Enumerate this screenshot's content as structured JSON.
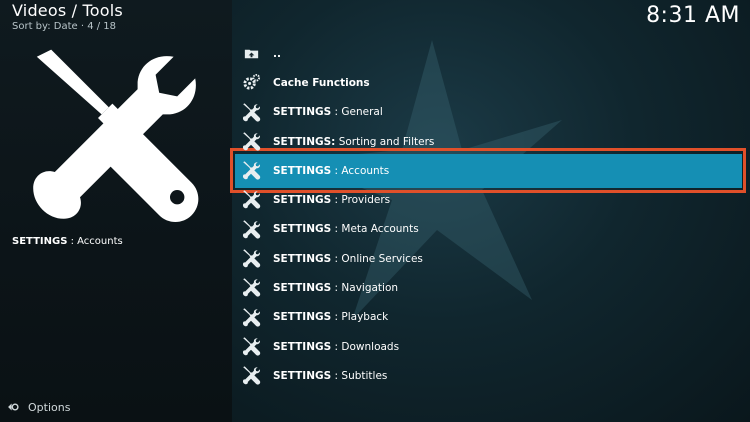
{
  "header": {
    "title": "Videos / Tools",
    "sort_label": "Sort by: Date · 4 / 18",
    "clock": "8:31 AM"
  },
  "left": {
    "big_icon": "tools-icon",
    "selected_prefix": "SETTINGS",
    "selected_suffix": " : Accounts",
    "options_label": "Options"
  },
  "list": {
    "items": [
      {
        "icon": "folder-up-icon",
        "bold": "..",
        "rest": ""
      },
      {
        "icon": "gears-icon",
        "bold": "Cache Functions",
        "rest": ""
      },
      {
        "icon": "tools-icon",
        "bold": "SETTINGS",
        "rest": " : General"
      },
      {
        "icon": "tools-icon",
        "bold": "SETTINGS:",
        "rest": " Sorting and Filters"
      },
      {
        "icon": "tools-icon",
        "bold": "SETTINGS",
        "rest": " : Accounts"
      },
      {
        "icon": "tools-icon",
        "bold": "SETTINGS",
        "rest": " : Providers"
      },
      {
        "icon": "tools-icon",
        "bold": "SETTINGS",
        "rest": " : Meta Accounts"
      },
      {
        "icon": "tools-icon",
        "bold": "SETTINGS",
        "rest": " : Online Services"
      },
      {
        "icon": "tools-icon",
        "bold": "SETTINGS",
        "rest": " : Navigation"
      },
      {
        "icon": "tools-icon",
        "bold": "SETTINGS",
        "rest": " : Playback"
      },
      {
        "icon": "tools-icon",
        "bold": "SETTINGS",
        "rest": " : Downloads"
      },
      {
        "icon": "tools-icon",
        "bold": "SETTINGS",
        "rest": " : Subtitles"
      }
    ],
    "selected_index": 4
  },
  "colors": {
    "selected_row": "#158fb4",
    "highlight_border": "#e0502a"
  }
}
